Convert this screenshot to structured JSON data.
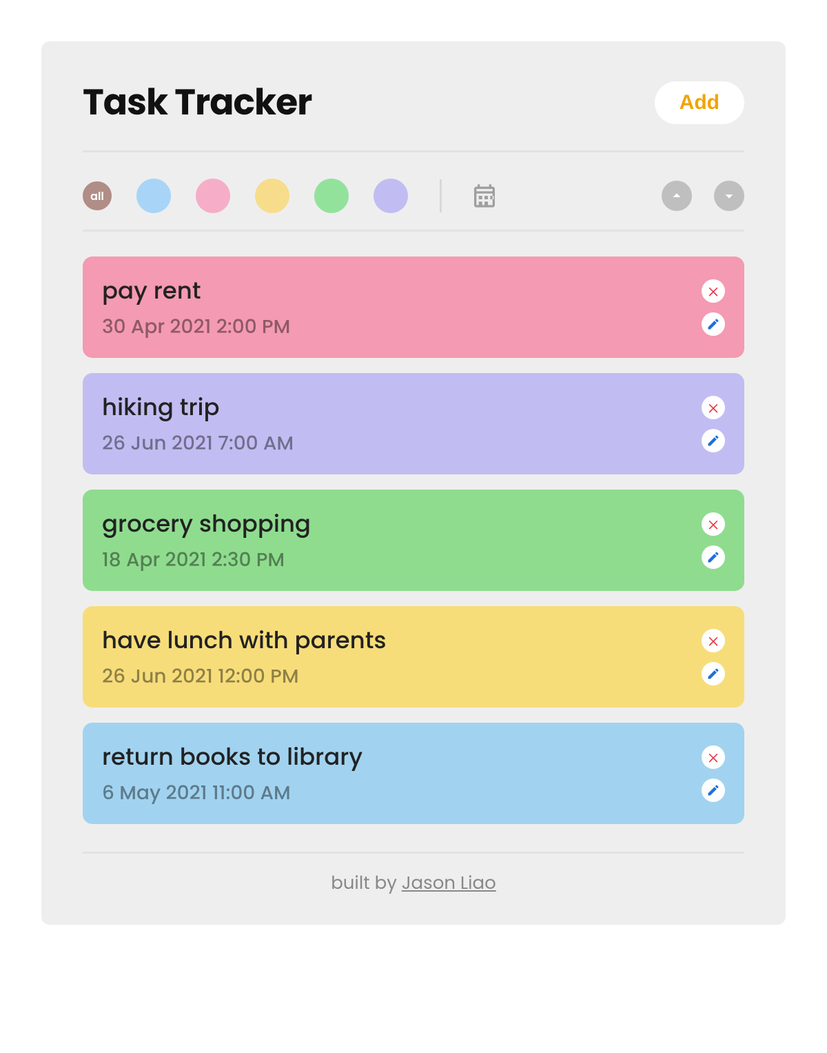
{
  "header": {
    "title": "Task Tracker",
    "add_label": "Add"
  },
  "filters": {
    "all_label": "all",
    "colors": [
      {
        "name": "blue",
        "hex": "#a8d5f7"
      },
      {
        "name": "pink",
        "hex": "#f6aec8"
      },
      {
        "name": "yellow",
        "hex": "#f7dd8b"
      },
      {
        "name": "green",
        "hex": "#93e29c"
      },
      {
        "name": "purple",
        "hex": "#c1bdf2"
      }
    ]
  },
  "tasks": [
    {
      "title": "pay rent",
      "date": "30 Apr 2021 2:00 PM",
      "color": "#f49ab2"
    },
    {
      "title": "hiking trip",
      "date": "26 Jun 2021 7:00 AM",
      "color": "#c1bdf2"
    },
    {
      "title": "grocery shopping",
      "date": "18 Apr 2021 2:30 PM",
      "color": "#8fdc8f"
    },
    {
      "title": "have lunch with parents",
      "date": "26 Jun 2021 12:00 PM",
      "color": "#f7dd7a"
    },
    {
      "title": "return books to library",
      "date": "6 May 2021 11:00 AM",
      "color": "#a1d3f0"
    }
  ],
  "footer": {
    "prefix": "built by ",
    "author": "Jason Liao"
  }
}
